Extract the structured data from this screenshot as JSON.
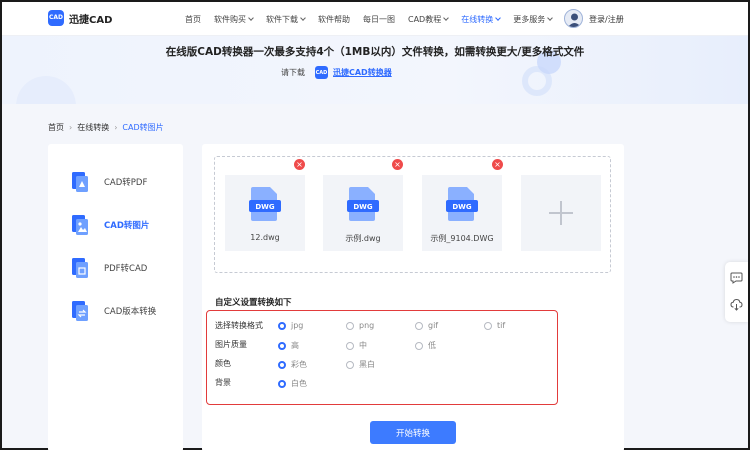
{
  "header": {
    "logo_badge": "CAD",
    "logo_text": "迅捷CAD",
    "nav": [
      {
        "label": "首页",
        "dropdown": false
      },
      {
        "label": "软件购买",
        "dropdown": true
      },
      {
        "label": "软件下载",
        "dropdown": true
      },
      {
        "label": "软件帮助",
        "dropdown": false
      },
      {
        "label": "每日一图",
        "dropdown": false
      },
      {
        "label": "CAD教程",
        "dropdown": true
      },
      {
        "label": "在线转换",
        "dropdown": true,
        "active": true
      },
      {
        "label": "更多服务",
        "dropdown": true
      }
    ],
    "login": "登录/注册"
  },
  "banner": {
    "title": "在线版CAD转换器一次最多支持4个（1MB以内）文件转换，如需转换更大/更多格式文件",
    "download_prefix": "请下载",
    "download_badge": "CAD",
    "download_link": "迅捷CAD转换器"
  },
  "breadcrumb": [
    "首页",
    "在线转换",
    "CAD转图片"
  ],
  "sidebar": {
    "items": [
      {
        "label": "CAD转PDF",
        "icon": "cad-to-pdf-icon",
        "active": false
      },
      {
        "label": "CAD转图片",
        "icon": "cad-to-image-icon",
        "active": true
      },
      {
        "label": "PDF转CAD",
        "icon": "pdf-to-cad-icon",
        "active": false
      },
      {
        "label": "CAD版本转换",
        "icon": "cad-version-icon",
        "active": false
      }
    ]
  },
  "files": [
    {
      "badge": "DWG",
      "name": "12.dwg"
    },
    {
      "badge": "DWG",
      "name": "示例.dwg"
    },
    {
      "badge": "DWG",
      "name": "示例_9104.DWG"
    }
  ],
  "settings": {
    "title": "自定义设置转换如下",
    "rows": [
      {
        "label": "选择转换格式",
        "options": [
          "jpg",
          "png",
          "gif",
          "tif"
        ],
        "selected": 0
      },
      {
        "label": "图片质量",
        "options": [
          "高",
          "中",
          "低"
        ],
        "selected": 0
      },
      {
        "label": "颜色",
        "options": [
          "彩色",
          "黑白"
        ],
        "selected": 0
      },
      {
        "label": "背景",
        "options": [
          "白色"
        ],
        "selected": 0
      }
    ]
  },
  "start_button": "开始转换",
  "float_tools": [
    {
      "icon": "chat-icon"
    },
    {
      "icon": "cloud-download-icon"
    }
  ],
  "colors": {
    "accent": "#2f6bff",
    "delete": "#ef4b4b",
    "highlight_border": "#e23b3b"
  },
  "delete_glyph": "×"
}
